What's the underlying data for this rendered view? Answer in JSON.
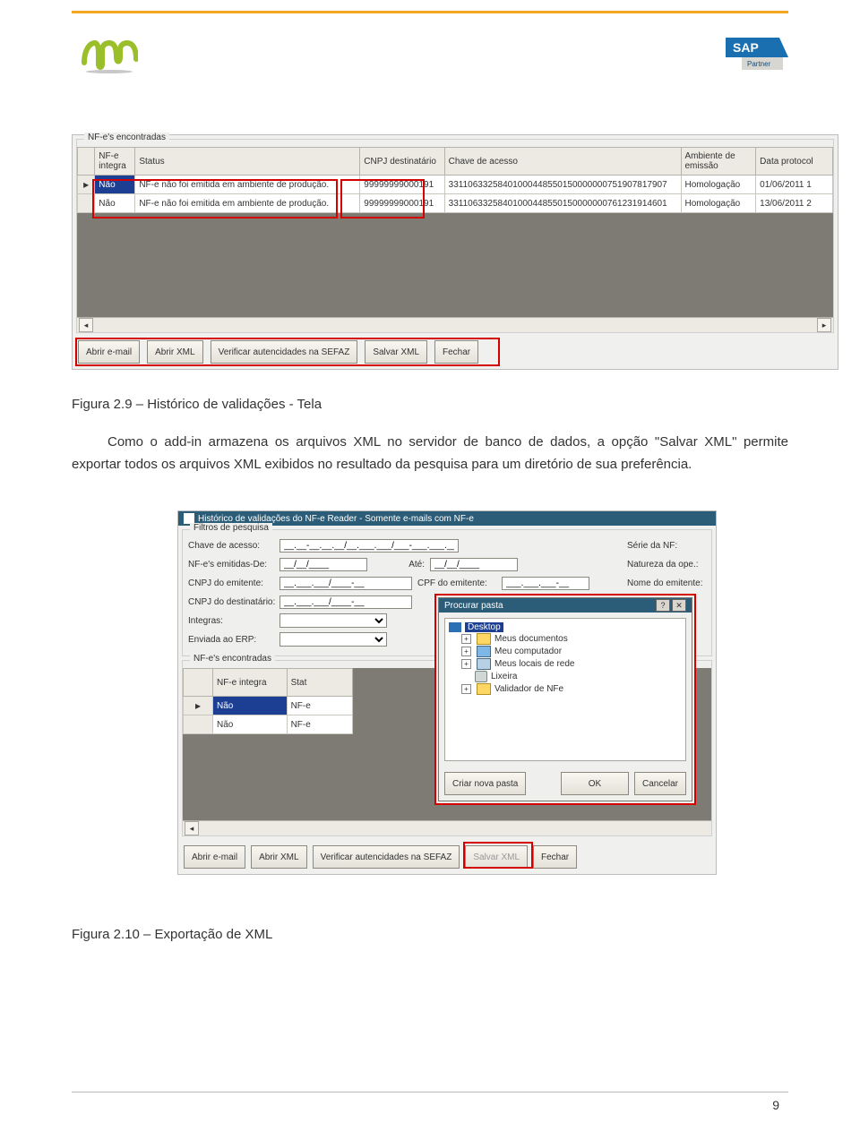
{
  "figure1": {
    "group_label": "NF-e's encontradas",
    "headers": {
      "integra": "NF-e integra",
      "status": "Status",
      "cnpj": "CNPJ destinatário",
      "chave": "Chave de acesso",
      "ambiente": "Ambiente de emissão",
      "data": "Data protocol"
    },
    "rows": [
      {
        "integra": "Não",
        "status": "NF-e não foi emitida em ambiente de produção.",
        "cnpj": "99999999000191",
        "chave": "33110633258401000448550150000000751907817907",
        "ambiente": "Homologação",
        "data": "01/06/2011 1"
      },
      {
        "integra": "Não",
        "status": "NF-e não foi emitida em ambiente de produção.",
        "cnpj": "99999999000191",
        "chave": "33110633258401000448550150000000761231914601",
        "ambiente": "Homologação",
        "data": "13/06/2011 2"
      }
    ],
    "buttons": {
      "abrir_email": "Abrir e-mail",
      "abrir_xml": "Abrir XML",
      "verificar": "Verificar autencidades na SEFAZ",
      "salvar_xml": "Salvar XML",
      "fechar": "Fechar"
    },
    "caption": "Figura 2.9 – Histórico de validações - Tela"
  },
  "paragraph": "Como o add-in armazena os arquivos XML no servidor de banco de dados, a opção \"Salvar XML\" permite exportar todos os arquivos XML exibidos no resultado da pesquisa para um diretório de sua preferência.",
  "figure2": {
    "window_title": "Histórico de validações do NF-e Reader - Somente e-mails com NF-e",
    "filters_label": "Filtros de pesquisa",
    "labels": {
      "chave": "Chave de acesso:",
      "emitidas": "NF-e's emitidas-De:",
      "ate": "Até:",
      "cnpj_emit": "CNPJ do emitente:",
      "cpf_emit": "CPF do emitente:",
      "cnpj_dest": "CNPJ do destinatário:",
      "integras": "Integras:",
      "enviada_erp": "Enviada ao ERP:",
      "serie": "Série da NF:",
      "natureza": "Natureza da ope.:",
      "nome": "Nome do emitente:"
    },
    "masks": {
      "chave": "__.__-__.__.__/__.___.___/___-___.___.___-__",
      "date": "__/__/____",
      "cnpj": "__.___.___/____-__",
      "cpf": "___.___.___-__"
    },
    "dialog": {
      "title": "Procurar pasta",
      "tree": {
        "desktop": "Desktop",
        "docs": "Meus documentos",
        "pc": "Meu computador",
        "net": "Meus locais de rede",
        "trash": "Lixeira",
        "validador": "Validador de NFe"
      },
      "buttons": {
        "new": "Criar nova pasta",
        "ok": "OK",
        "cancel": "Cancelar"
      }
    },
    "group_label": "NF-e's encontradas",
    "grid2_headers": {
      "integra": "NF-e integra",
      "stat": "Stat"
    },
    "grid2_rows": [
      {
        "integra": "Não",
        "stat": "NF-e"
      },
      {
        "integra": "Não",
        "stat": "NF-e"
      }
    ],
    "buttons": {
      "abrir_email": "Abrir e-mail",
      "abrir_xml": "Abrir XML",
      "verificar": "Verificar autencidades na SEFAZ",
      "salvar_xml": "Salvar XML",
      "fechar": "Fechar"
    },
    "caption": "Figura 2.10 – Exportação de XML"
  },
  "page_number": "9"
}
